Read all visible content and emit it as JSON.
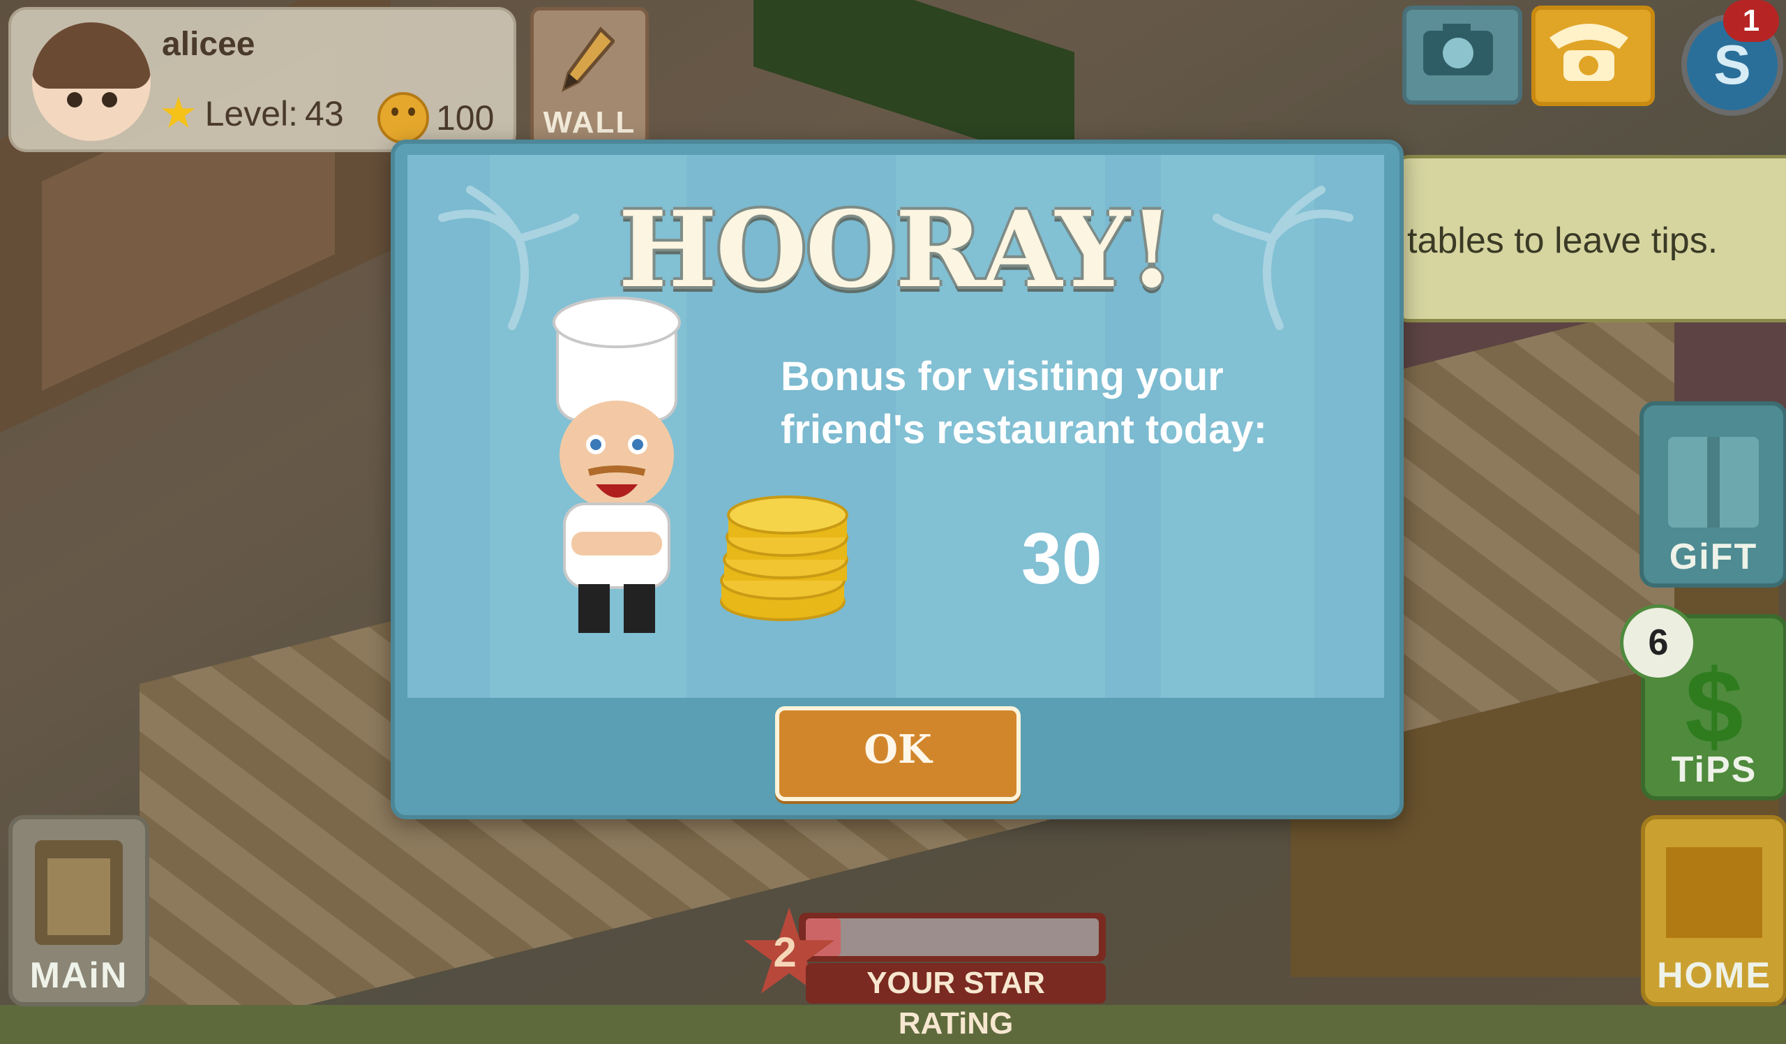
{
  "player": {
    "name": "alicee",
    "level_label": "Level:",
    "level_value": "43",
    "coins": "100"
  },
  "toolbar": {
    "wall_label": "WALL",
    "notification_count": "1",
    "cash_symbol": "S"
  },
  "tip_bubble": {
    "text": "tables to leave tips."
  },
  "side_buttons": {
    "gift_label": "GiFT",
    "tips_label": "TiPS",
    "tips_count": "6",
    "home_label": "HOME",
    "main_label": "MAiN"
  },
  "star_rating": {
    "value": "2",
    "label": "YOUR STAR RATiNG",
    "progress_fraction": 0.12
  },
  "modal": {
    "title": "HOORAY!",
    "bonus_line1": "Bonus for visiting your",
    "bonus_line2": "friend's restaurant today:",
    "reward_amount": "30",
    "ok_label": "OK"
  },
  "colors": {
    "modal_bg": "#7bbad0",
    "ok_button": "#d2862c",
    "tips_green": "#4f8a3d",
    "home_gold": "#caa131",
    "gift_teal": "#4e8b92"
  }
}
